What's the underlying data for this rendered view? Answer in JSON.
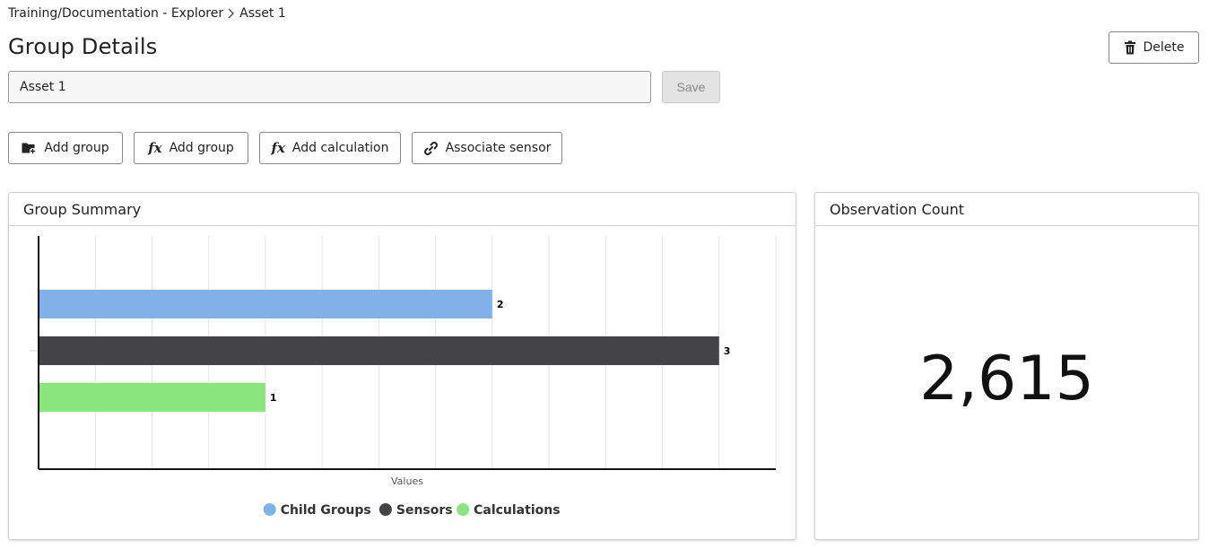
{
  "breadcrumb": {
    "parent": "Training/Documentation - Explorer",
    "current": "Asset 1"
  },
  "page": {
    "title": "Group Details"
  },
  "actions": {
    "delete_label": "Delete",
    "save_label": "Save"
  },
  "name_field": {
    "value": "Asset 1"
  },
  "toolbar": {
    "add_group_label": "Add group",
    "add_group_fx_label": "Add group",
    "add_calculation_label": "Add calculation",
    "associate_sensor_label": "Associate sensor"
  },
  "group_summary": {
    "title": "Group Summary"
  },
  "observation_count": {
    "title": "Observation Count",
    "value": "2,615"
  },
  "icons": {
    "delete": "trash-icon",
    "add_group": "folder-plus-icon",
    "add_group_fx": "function-icon",
    "add_calculation": "function-icon",
    "associate_sensor": "link-icon",
    "breadcrumb_separator": "chevron-right-icon"
  },
  "colors": {
    "child_groups": "#82b1ea",
    "sensors": "#434348",
    "calculations": "#8ae57e"
  },
  "chart_data": {
    "type": "bar",
    "orientation": "horizontal",
    "xlabel": "Values",
    "grid": true,
    "legend_position": "bottom-center",
    "xlim": [
      0,
      3.25
    ],
    "series": [
      {
        "name": "Child Groups",
        "value": 2,
        "color": "#82b1ea"
      },
      {
        "name": "Sensors",
        "value": 3,
        "color": "#434348"
      },
      {
        "name": "Calculations",
        "value": 1,
        "color": "#8ae57e"
      }
    ]
  }
}
